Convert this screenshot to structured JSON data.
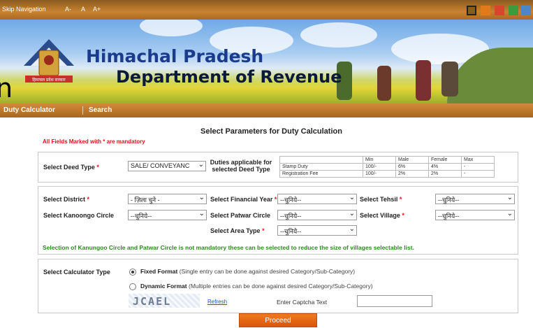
{
  "topbar": {
    "skip_navigation": "Skip Navigation",
    "font_decrease": "A-",
    "font_normal": "A",
    "font_increase": "A+",
    "theme_colors": [
      "#222222",
      "#e07a1a",
      "#d6452c",
      "#3e9a3a",
      "#4a86c8"
    ]
  },
  "banner": {
    "title_line1": "Himachal Pradesh",
    "title_line2": "Department of Revenue",
    "emblem_text": "हिमाचल प्रदेश सरकार"
  },
  "left_fragment": "n",
  "nav": {
    "items": [
      "Duty Calculator",
      "Search"
    ]
  },
  "form": {
    "title": "Select Parameters for Duty Calculation",
    "mandatory_note": "All Fields Marked with * are mandatory",
    "deed_type": {
      "label": "Select Deed Type",
      "value": "SALE/ CONVEYANC"
    },
    "duties_label": "Duties applicable for selected Deed Type",
    "duty_table": {
      "headers": [
        "",
        "Min",
        "Male",
        "Female",
        "Max"
      ],
      "rows": [
        [
          "Stamp Duty",
          "100/-",
          "6%",
          "4%",
          "-"
        ],
        [
          "Registration Fee",
          "100/-",
          "2%",
          "2%",
          "-"
        ]
      ]
    },
    "district": {
      "label": "Select District",
      "value": "- ज़िला चुने -"
    },
    "financial_year": {
      "label": "Select Financial Year",
      "value": "--चुनिये--"
    },
    "tehsil": {
      "label": "Select Tehsil",
      "value": "--चुनिये--"
    },
    "kanoongo": {
      "label": "Select Kanoongo Circle",
      "value": "--चुनिये--"
    },
    "patwar": {
      "label": "Select Patwar Circle",
      "value": "--चुनिये--"
    },
    "village": {
      "label": "Select Village",
      "value": "--चुनिये--"
    },
    "area_type": {
      "label": "Select Area Type",
      "value": "--चुनिये--"
    },
    "circle_note": "Selection of Kanungoo Circle and Patwar Circle is not mandatory these can be selected to reduce the size of villages selectable list.",
    "calculator": {
      "label": "Select Calculator Type",
      "fixed_title": "Fixed Format",
      "fixed_desc": "(Single entry can be done against desired Category/Sub-Category)",
      "dynamic_title": "Dynamic Format",
      "dynamic_desc": "(Multiple entries can be done against desired Category/Sub-Category)",
      "selected": "fixed"
    },
    "captcha": {
      "image_text": "JCAEL",
      "refresh": "Refresh",
      "label": "Enter Captcha Text",
      "value": ""
    },
    "proceed": "Proceed"
  }
}
